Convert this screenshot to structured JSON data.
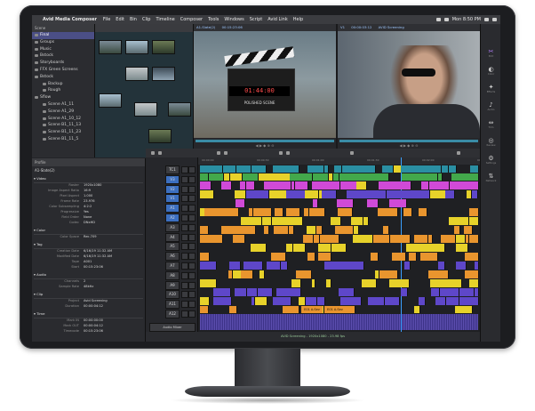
{
  "menubar": {
    "app_name": "Avid Media Composer",
    "items": [
      "File",
      "Edit",
      "Bin",
      "Clip",
      "Timeline",
      "Composer",
      "Tools",
      "Windows",
      "Script",
      "Avid Link",
      "Help"
    ],
    "clock": "Mon 8:50 PM"
  },
  "bins": {
    "header": "Scene",
    "items": [
      {
        "label": "Final",
        "level": 0,
        "selected": true
      },
      {
        "label": "Groups",
        "level": 0
      },
      {
        "label": "Music",
        "level": 0
      },
      {
        "label": "Bstock",
        "level": 0
      },
      {
        "label": "Storyboards",
        "level": 0
      },
      {
        "label": "FFX Green Screens",
        "level": 0
      },
      {
        "label": "Bstock",
        "level": 0
      },
      {
        "label": "Backup",
        "level": 1
      },
      {
        "label": "Rough",
        "level": 1
      },
      {
        "label": "Sflow",
        "level": 0
      },
      {
        "label": "Scene A1_11",
        "level": 1
      },
      {
        "label": "Scene A1_29",
        "level": 1
      },
      {
        "label": "Scene A1_10_12",
        "level": 1
      },
      {
        "label": "Scene B1_11_13",
        "level": 1
      },
      {
        "label": "Scene B1_11_23",
        "level": 1
      },
      {
        "label": "Scene B1_11_5",
        "level": 1
      }
    ]
  },
  "source_monitor": {
    "clip_name": "A1-Slate(2)",
    "timecode": "00:15:23:06",
    "slate_timecode": "01:44:00",
    "slate_text": "POLISHED SCENE"
  },
  "record_monitor": {
    "track": "V1",
    "timecode": "00:00:03:12",
    "sequence": "AVID Screening"
  },
  "tools": [
    {
      "name": "Edit",
      "glyph": "✂"
    },
    {
      "name": "Color",
      "glyph": "◐"
    },
    {
      "name": "Effects",
      "glyph": "✦"
    },
    {
      "name": "Audio",
      "glyph": "♪"
    },
    {
      "name": "Trim",
      "glyph": "⇔"
    },
    {
      "name": "Review",
      "glyph": "◎"
    },
    {
      "name": "Settings",
      "glyph": "⚙"
    },
    {
      "name": "Network",
      "glyph": "⇅"
    }
  ],
  "inspector": {
    "header": "Profile",
    "name": "A1-Slate(2)",
    "sections": [
      {
        "title": "Video",
        "rows": [
          {
            "key": "Raster",
            "value": "1920x1080"
          },
          {
            "key": "Image Aspect Ratio",
            "value": "16:9"
          },
          {
            "key": "Pixel Aspect",
            "value": "1.000"
          },
          {
            "key": "Frame Rate",
            "value": "23.976"
          },
          {
            "key": "Color Subsampling",
            "value": "4:2:2"
          },
          {
            "key": "Progressive",
            "value": "Yes"
          },
          {
            "key": "Field Order",
            "value": "None"
          },
          {
            "key": "Codec",
            "value": "DNxHD"
          }
        ]
      },
      {
        "title": "Color",
        "rows": [
          {
            "key": "Color Space",
            "value": "Rec.709"
          }
        ]
      },
      {
        "title": "Tag",
        "rows": [
          {
            "key": "Creation Date",
            "value": "6/16/19 11:32 AM"
          },
          {
            "key": "Modified Date",
            "value": "6/16/19 11:32 AM"
          },
          {
            "key": "Tape",
            "value": "A001"
          },
          {
            "key": "Start",
            "value": "00:15:23:06"
          }
        ]
      },
      {
        "title": "Audio",
        "rows": [
          {
            "key": "Channels",
            "value": "2"
          },
          {
            "key": "Sample Rate",
            "value": "48kHz"
          }
        ]
      },
      {
        "title": "Clip",
        "rows": [
          {
            "key": "Project",
            "value": "Avid Screening"
          },
          {
            "key": "Duration",
            "value": "00:00:04:12"
          }
        ]
      },
      {
        "title": "Time",
        "rows": [
          {
            "key": "Mark IN",
            "value": "00:00:00:00"
          },
          {
            "key": "Mark OUT",
            "value": "00:00:04:12"
          },
          {
            "key": "Timecode",
            "value": "00:15:23:06"
          }
        ]
      }
    ]
  },
  "timeline": {
    "ruler": [
      "00:00:00",
      "00:00:30",
      "00:01:00",
      "00:01:30",
      "00:02:00",
      "00:02:30"
    ],
    "tracks": [
      "TC1",
      "V3",
      "V2",
      "V1",
      "A1",
      "A2",
      "A3",
      "A4",
      "A5",
      "A6",
      "A7",
      "A8",
      "A9",
      "A10",
      "A11",
      "A12"
    ],
    "audio_button": "Audio Mixer",
    "status": "AVID Screening - 1920x1080 - 23.98 fps",
    "clip_labels": [
      "E01 A.Sev",
      "E01 A.Sev"
    ]
  },
  "colors": {
    "accent_purple": "#8a6cff",
    "clip_green": "#43a84b",
    "clip_magenta": "#d04ad7",
    "clip_orange": "#e9952e",
    "clip_yellow": "#e7d22a",
    "clip_purple": "#5e47c9",
    "clip_teal": "#2a8fa3",
    "playhead": "#3aa0ff"
  }
}
